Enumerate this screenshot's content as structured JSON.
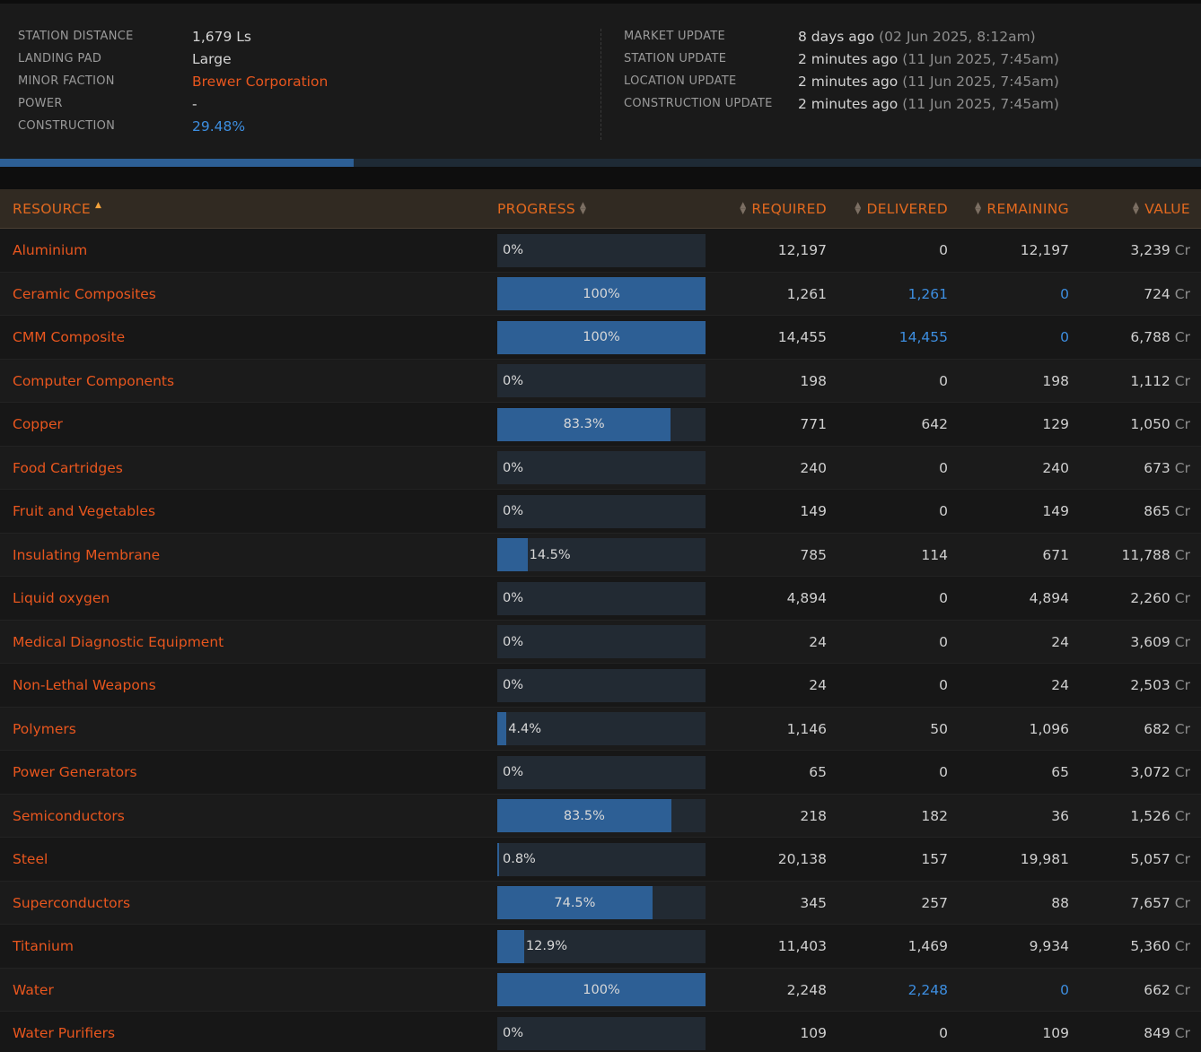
{
  "station_info": {
    "left": [
      {
        "label": "STATION DISTANCE",
        "value": "1,679 Ls",
        "style": ""
      },
      {
        "label": "LANDING PAD",
        "value": "Large",
        "style": ""
      },
      {
        "label": "MINOR FACTION",
        "value": "Brewer Corporation",
        "style": "orange"
      },
      {
        "label": "POWER",
        "value": "-",
        "style": ""
      },
      {
        "label": "CONSTRUCTION",
        "value": "29.48%",
        "style": "blue"
      }
    ],
    "right": [
      {
        "label": "MARKET UPDATE",
        "value": "8 days ago",
        "paren": "(02 Jun 2025, 8:12am)"
      },
      {
        "label": "STATION UPDATE",
        "value": "2 minutes ago",
        "paren": "(11 Jun 2025, 7:45am)"
      },
      {
        "label": "LOCATION UPDATE",
        "value": "2 minutes ago",
        "paren": "(11 Jun 2025, 7:45am)"
      },
      {
        "label": "CONSTRUCTION UPDATE",
        "value": "2 minutes ago",
        "paren": "(11 Jun 2025, 7:45am)"
      }
    ]
  },
  "construction_progress": 29.48,
  "colors": {
    "accent_orange": "#e8561e",
    "accent_blue": "#3d8ee0",
    "bar_fill": "#2d5f95",
    "bar_track": "#222a33"
  },
  "table": {
    "headers": {
      "resource": "RESOURCE",
      "progress": "PROGRESS",
      "required": "REQUIRED",
      "delivered": "DELIVERED",
      "remaining": "REMAINING",
      "value": "VALUE"
    },
    "sorted_by": "resource",
    "currency_suffix": "Cr",
    "rows": [
      {
        "name": "Aluminium",
        "progress": 0,
        "progress_label": "0%",
        "required": "12,197",
        "delivered": "0",
        "remaining": "12,197",
        "value": "3,239"
      },
      {
        "name": "Ceramic Composites",
        "progress": 100,
        "progress_label": "100%",
        "required": "1,261",
        "delivered": "1,261",
        "remaining": "0",
        "value": "724"
      },
      {
        "name": "CMM Composite",
        "progress": 100,
        "progress_label": "100%",
        "required": "14,455",
        "delivered": "14,455",
        "remaining": "0",
        "value": "6,788"
      },
      {
        "name": "Computer Components",
        "progress": 0,
        "progress_label": "0%",
        "required": "198",
        "delivered": "0",
        "remaining": "198",
        "value": "1,112"
      },
      {
        "name": "Copper",
        "progress": 83.3,
        "progress_label": "83.3%",
        "required": "771",
        "delivered": "642",
        "remaining": "129",
        "value": "1,050"
      },
      {
        "name": "Food Cartridges",
        "progress": 0,
        "progress_label": "0%",
        "required": "240",
        "delivered": "0",
        "remaining": "240",
        "value": "673"
      },
      {
        "name": "Fruit and Vegetables",
        "progress": 0,
        "progress_label": "0%",
        "required": "149",
        "delivered": "0",
        "remaining": "149",
        "value": "865"
      },
      {
        "name": "Insulating Membrane",
        "progress": 14.5,
        "progress_label": "14.5%",
        "required": "785",
        "delivered": "114",
        "remaining": "671",
        "value": "11,788"
      },
      {
        "name": "Liquid oxygen",
        "progress": 0,
        "progress_label": "0%",
        "required": "4,894",
        "delivered": "0",
        "remaining": "4,894",
        "value": "2,260"
      },
      {
        "name": "Medical Diagnostic Equipment",
        "progress": 0,
        "progress_label": "0%",
        "required": "24",
        "delivered": "0",
        "remaining": "24",
        "value": "3,609"
      },
      {
        "name": "Non-Lethal Weapons",
        "progress": 0,
        "progress_label": "0%",
        "required": "24",
        "delivered": "0",
        "remaining": "24",
        "value": "2,503"
      },
      {
        "name": "Polymers",
        "progress": 4.4,
        "progress_label": "4.4%",
        "required": "1,146",
        "delivered": "50",
        "remaining": "1,096",
        "value": "682"
      },
      {
        "name": "Power Generators",
        "progress": 0,
        "progress_label": "0%",
        "required": "65",
        "delivered": "0",
        "remaining": "65",
        "value": "3,072"
      },
      {
        "name": "Semiconductors",
        "progress": 83.5,
        "progress_label": "83.5%",
        "required": "218",
        "delivered": "182",
        "remaining": "36",
        "value": "1,526"
      },
      {
        "name": "Steel",
        "progress": 0.8,
        "progress_label": "0.8%",
        "required": "20,138",
        "delivered": "157",
        "remaining": "19,981",
        "value": "5,057"
      },
      {
        "name": "Superconductors",
        "progress": 74.5,
        "progress_label": "74.5%",
        "required": "345",
        "delivered": "257",
        "remaining": "88",
        "value": "7,657"
      },
      {
        "name": "Titanium",
        "progress": 12.9,
        "progress_label": "12.9%",
        "required": "11,403",
        "delivered": "1,469",
        "remaining": "9,934",
        "value": "5,360"
      },
      {
        "name": "Water",
        "progress": 100,
        "progress_label": "100%",
        "required": "2,248",
        "delivered": "2,248",
        "remaining": "0",
        "value": "662"
      },
      {
        "name": "Water Purifiers",
        "progress": 0,
        "progress_label": "0%",
        "required": "109",
        "delivered": "0",
        "remaining": "109",
        "value": "849"
      }
    ]
  }
}
